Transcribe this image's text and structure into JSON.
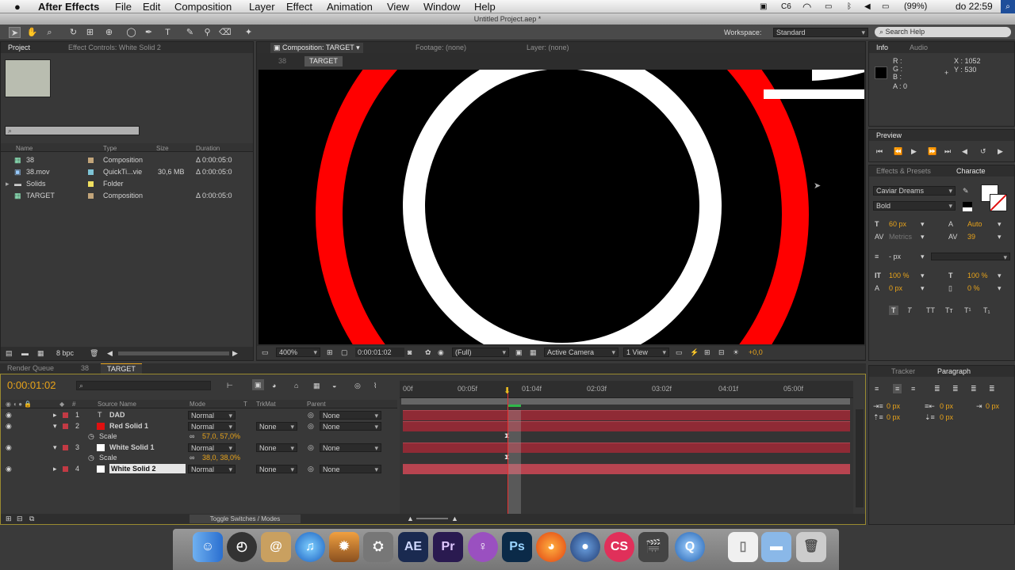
{
  "menubar": {
    "app": "After Effects",
    "items": [
      "File",
      "Edit",
      "Composition",
      "Layer",
      "Effect",
      "Animation",
      "View",
      "Window",
      "Help"
    ],
    "cs_badge": "C6",
    "battery": "(99%)",
    "clock": "do 22:59"
  },
  "title": "Untitled Project.aep *",
  "workspace": {
    "label": "Workspace:",
    "value": "Standard",
    "search": "Search Help"
  },
  "project": {
    "tab": "Project",
    "tab2": "Effect Controls: White Solid 2",
    "depth": "8 bpc",
    "headers": {
      "name": "Name",
      "type": "Type",
      "size": "Size",
      "duration": "Duration"
    },
    "items": [
      {
        "name": "38",
        "type": "Composition",
        "size": "",
        "duration": "Δ 0:00:05:0",
        "color": "#c2a57a"
      },
      {
        "name": "38.mov",
        "type": "QuickTi...vie",
        "size": "30,6 MB",
        "duration": "Δ 0:00:05:0",
        "color": "#7ec4d6"
      },
      {
        "name": "Solids",
        "type": "Folder",
        "size": "",
        "duration": "",
        "color": "#f0e060"
      },
      {
        "name": "TARGET",
        "type": "Composition",
        "size": "",
        "duration": "Δ 0:00:05:0",
        "color": "#c2a57a"
      }
    ]
  },
  "viewer": {
    "tab": "Composition: TARGET",
    "footage": "Footage: (none)",
    "layer": "Layer: (none)",
    "crumb1": "38",
    "crumb2": "TARGET",
    "zoom": "400%",
    "time": "0:00:01:02",
    "res": "(Full)",
    "camera": "Active Camera",
    "views": "1 View",
    "exposure": "+0,0"
  },
  "info": {
    "tab": "Info",
    "tab2": "Audio",
    "r": "R :",
    "g": "G :",
    "b": "B :",
    "a": "A : 0",
    "x": "X : 1052",
    "y": "Y : 530"
  },
  "preview": {
    "tab": "Preview"
  },
  "character": {
    "tab1": "Effects & Presets",
    "tab2": "Characte",
    "font": "Caviar Dreams",
    "style": "Bold",
    "size": "60 px",
    "leading": "Auto",
    "kern": "Metrics",
    "track": "39",
    "stroke": "- px",
    "vscale": "100 %",
    "hscale": "100 %",
    "baseline": "0 px",
    "tsume": "0 %"
  },
  "timeline": {
    "tabs": [
      "Render Queue",
      "38",
      "TARGET"
    ],
    "timecode": "0:00:01:02",
    "ruler": [
      "00f",
      "00:05f",
      "01:04f",
      "02:03f",
      "03:02f",
      "04:01f",
      "05:00f"
    ],
    "headers": {
      "source": "Source Name",
      "mode": "Mode",
      "t": "T",
      "trkmat": "TrkMat",
      "parent": "Parent"
    },
    "layers": [
      {
        "num": "1",
        "name": "DAD",
        "mode": "Normal",
        "trkmat": "",
        "parent": "None",
        "color": "#c23a44",
        "swatch": "none"
      },
      {
        "num": "2",
        "name": "Red Solid 1",
        "mode": "Normal",
        "trkmat": "None",
        "parent": "None",
        "color": "#c23a44",
        "swatch": "#e01010"
      },
      {
        "num": "",
        "name": "Scale",
        "value": "57,0, 57,0%"
      },
      {
        "num": "3",
        "name": "White Solid 1",
        "mode": "Normal",
        "trkmat": "None",
        "parent": "None",
        "color": "#c23a44",
        "swatch": "#ffffff"
      },
      {
        "num": "",
        "name": "Scale",
        "value": "38,0, 38,0%"
      },
      {
        "num": "4",
        "name": "White Solid 2",
        "mode": "Normal",
        "trkmat": "None",
        "parent": "None",
        "color": "#c23a44",
        "swatch": "#ffffff"
      }
    ],
    "toggle": "Toggle Switches / Modes"
  },
  "tracker": {
    "tab1": "Tracker",
    "tab2": "Paragraph",
    "vals": [
      "0 px",
      "0 px",
      "0 px",
      "0 px",
      "0 px"
    ]
  },
  "dock": {
    "ae": "AE",
    "pr": "Pr",
    "ps": "Ps",
    "cs": "CS"
  }
}
